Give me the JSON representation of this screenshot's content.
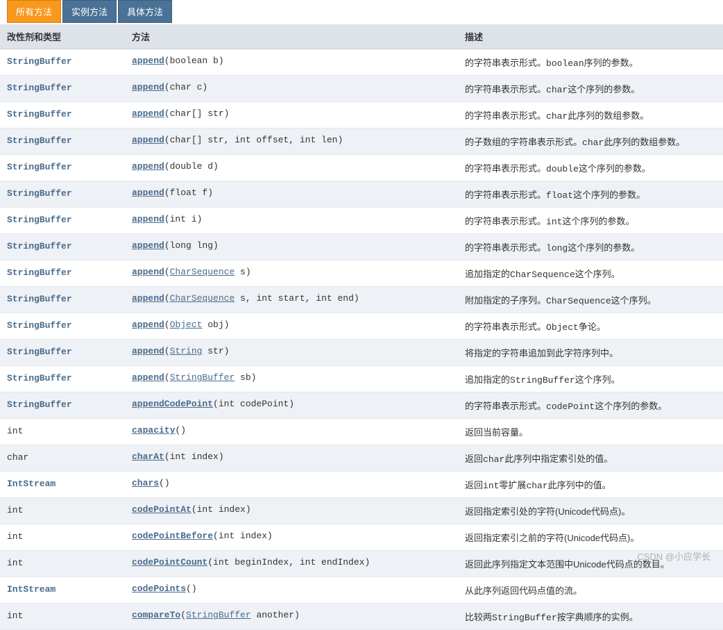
{
  "tabs": [
    {
      "label": "所有方法",
      "active": true
    },
    {
      "label": "实例方法",
      "active": false
    },
    {
      "label": "具体方法",
      "active": false
    }
  ],
  "headers": {
    "type": "改性剂和类型",
    "method": "方法",
    "desc": "描述"
  },
  "rows": [
    {
      "typeHtml": "<a class='type-link' href='#'>StringBuffer</a>",
      "methodHtml": "<a class='method-name' href='#'>append</a><span class='method-sig'>(boolean b)</span>",
      "descHtml": "的字符串表示形式。<span class='desc-code'>boolean</span>序列的参数。"
    },
    {
      "typeHtml": "<a class='type-link' href='#'>StringBuffer</a>",
      "methodHtml": "<a class='method-name' href='#'>append</a><span class='method-sig'>(char c)</span>",
      "descHtml": "的字符串表示形式。<span class='desc-code'>char</span>这个序列的参数。"
    },
    {
      "typeHtml": "<a class='type-link' href='#'>StringBuffer</a>",
      "methodHtml": "<a class='method-name' href='#'>append</a><span class='method-sig'>(char[] str)</span>",
      "descHtml": "的字符串表示形式。<span class='desc-code'>char</span>此序列的数组参数。"
    },
    {
      "typeHtml": "<a class='type-link' href='#'>StringBuffer</a>",
      "methodHtml": "<a class='method-name' href='#'>append</a><span class='method-sig'>(char[] str, int offset, int len)</span>",
      "descHtml": "的子数组的字符串表示形式。<span class='desc-code'>char</span>此序列的数组参数。"
    },
    {
      "typeHtml": "<a class='type-link' href='#'>StringBuffer</a>",
      "methodHtml": "<a class='method-name' href='#'>append</a><span class='method-sig'>(double d)</span>",
      "descHtml": "的字符串表示形式。<span class='desc-code'>double</span>这个序列的参数。"
    },
    {
      "typeHtml": "<a class='type-link' href='#'>StringBuffer</a>",
      "methodHtml": "<a class='method-name' href='#'>append</a><span class='method-sig'>(float f)</span>",
      "descHtml": "的字符串表示形式。<span class='desc-code'>float</span>这个序列的参数。"
    },
    {
      "typeHtml": "<a class='type-link' href='#'>StringBuffer</a>",
      "methodHtml": "<a class='method-name' href='#'>append</a><span class='method-sig'>(int i)</span>",
      "descHtml": "的字符串表示形式。<span class='desc-code'>int</span>这个序列的参数。"
    },
    {
      "typeHtml": "<a class='type-link' href='#'>StringBuffer</a>",
      "methodHtml": "<a class='method-name' href='#'>append</a><span class='method-sig'>(long lng)</span>",
      "descHtml": "的字符串表示形式。<span class='desc-code'>long</span>这个序列的参数。"
    },
    {
      "typeHtml": "<a class='type-link' href='#'>StringBuffer</a>",
      "methodHtml": "<a class='method-name' href='#'>append</a><span class='method-sig'>(<a class='param-type-link' href='#'>CharSequence</a> s)</span>",
      "descHtml": "追加指定的<span class='desc-code'>CharSequence</span>这个序列。"
    },
    {
      "typeHtml": "<a class='type-link' href='#'>StringBuffer</a>",
      "methodHtml": "<a class='method-name' href='#'>append</a><span class='method-sig'>(<a class='param-type-link' href='#'>CharSequence</a> s, int start, int end)</span>",
      "descHtml": "附加指定的子序列。<span class='desc-code'>CharSequence</span>这个序列。"
    },
    {
      "typeHtml": "<a class='type-link' href='#'>StringBuffer</a>",
      "methodHtml": "<a class='method-name' href='#'>append</a><span class='method-sig'>(<a class='param-type-link' href='#'>Object</a> obj)</span>",
      "descHtml": "的字符串表示形式。<span class='desc-code'>Object</span>争论。"
    },
    {
      "typeHtml": "<a class='type-link' href='#'>StringBuffer</a>",
      "methodHtml": "<a class='method-name' href='#'>append</a><span class='method-sig'>(<a class='param-type-link' href='#'>String</a> str)</span>",
      "descHtml": "将指定的字符串追加到此字符序列中。"
    },
    {
      "typeHtml": "<a class='type-link' href='#'>StringBuffer</a>",
      "methodHtml": "<a class='method-name' href='#'>append</a><span class='method-sig'>(<a class='param-type-link' href='#'>StringBuffer</a> sb)</span>",
      "descHtml": "追加指定的<span class='desc-code'>StringBuffer</span>这个序列。"
    },
    {
      "typeHtml": "<a class='type-link' href='#'>StringBuffer</a>",
      "methodHtml": "<a class='method-name' href='#'>appendCodePoint</a><span class='method-sig'>(int codePoint)</span>",
      "descHtml": "的字符串表示形式。<span class='desc-code'>codePoint</span>这个序列的参数。"
    },
    {
      "typeHtml": "<span class='type-plain'>int</span>",
      "methodHtml": "<a class='method-name' href='#'>capacity</a><span class='method-sig'>()</span>",
      "descHtml": "返回当前容量。"
    },
    {
      "typeHtml": "<span class='type-plain'>char</span>",
      "methodHtml": "<a class='method-name' href='#'>charAt</a><span class='method-sig'>(int index)</span>",
      "descHtml": "返回<span class='desc-code'>char</span>此序列中指定索引处的值。"
    },
    {
      "typeHtml": "<a class='type-link' href='#'>IntStream</a>",
      "methodHtml": "<a class='method-name' href='#'>chars</a><span class='method-sig'>()</span>",
      "descHtml": "返回<span class='desc-code'>int</span>零扩展<span class='desc-code'>char</span>此序列中的值。"
    },
    {
      "typeHtml": "<span class='type-plain'>int</span>",
      "methodHtml": "<a class='method-name' href='#'>codePointAt</a><span class='method-sig'>(int index)</span>",
      "descHtml": "返回指定索引处的字符(Unicode代码点)。"
    },
    {
      "typeHtml": "<span class='type-plain'>int</span>",
      "methodHtml": "<a class='method-name' href='#'>codePointBefore</a><span class='method-sig'>(int index)</span>",
      "descHtml": "返回指定索引之前的字符(Unicode代码点)。"
    },
    {
      "typeHtml": "<span class='type-plain'>int</span>",
      "methodHtml": "<a class='method-name' href='#'>codePointCount</a><span class='method-sig'>(int beginIndex, int endIndex)</span>",
      "descHtml": "返回此序列指定文本范围中Unicode代码点的数目。"
    },
    {
      "typeHtml": "<a class='type-link' href='#'>IntStream</a>",
      "methodHtml": "<a class='method-name' href='#'>codePoints</a><span class='method-sig'>()</span>",
      "descHtml": "从此序列返回代码点值的流。"
    },
    {
      "typeHtml": "<span class='type-plain'>int</span>",
      "methodHtml": "<a class='method-name' href='#'>compareTo</a><span class='method-sig'>(<a class='param-type-link' href='#'>StringBuffer</a> another)</span>",
      "descHtml": "比较两<span class='desc-code'>StringBuffer</span>按字典顺序的实例。"
    }
  ],
  "watermark": "CSDN @小应学长"
}
